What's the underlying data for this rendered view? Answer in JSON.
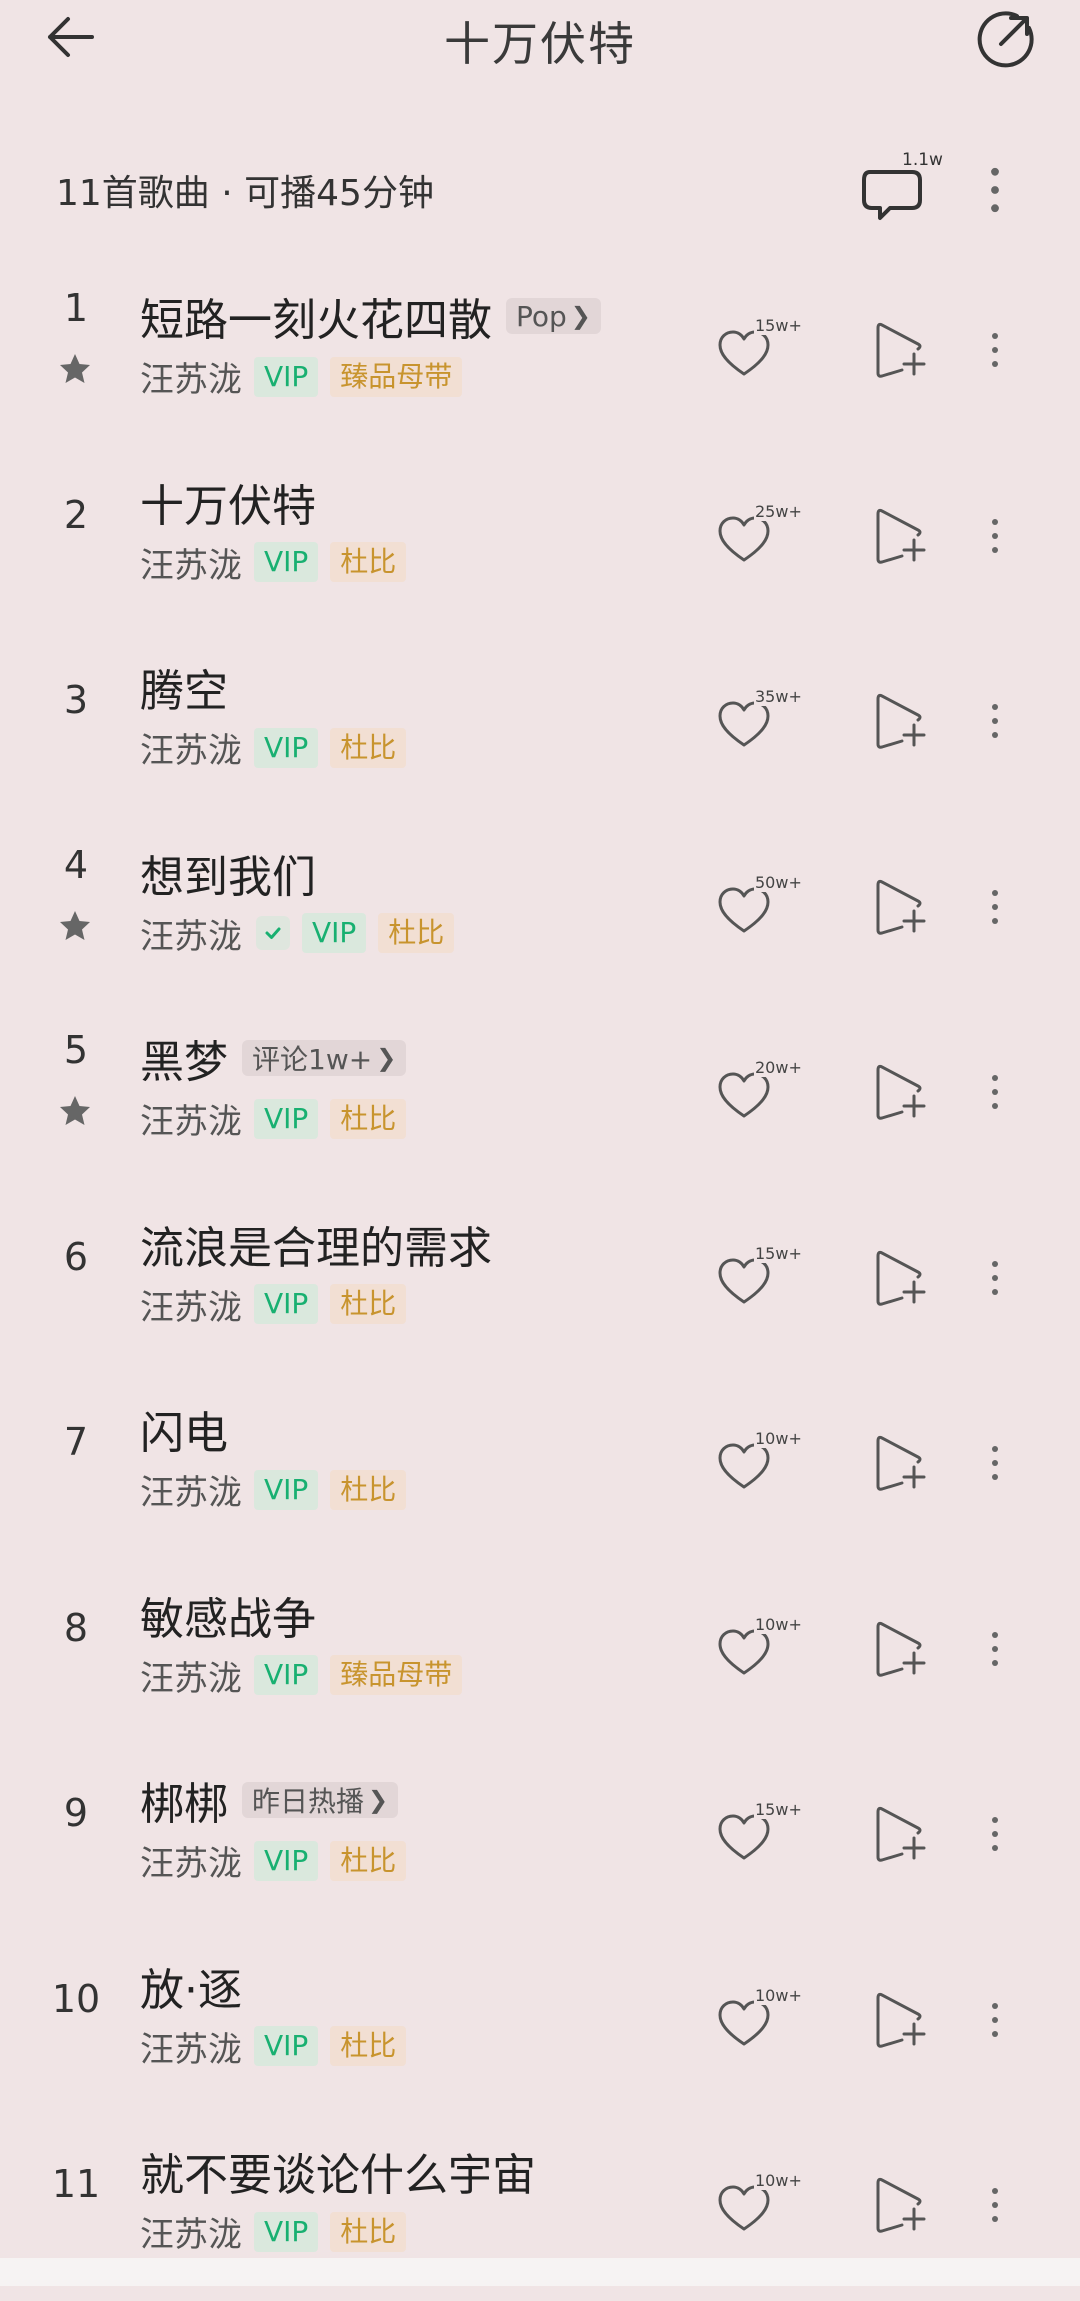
{
  "header": {
    "title": "十万伏特",
    "back_icon": "arrow-left-icon",
    "share_icon": "share-icon"
  },
  "summary": {
    "text": "11首歌曲 · 可播45分钟",
    "comment_count": "1.1w",
    "comment_icon": "comment-icon",
    "more_icon": "more-vertical-icon"
  },
  "colors": {
    "background": "#f0e4e5",
    "vip_green": "#18b071",
    "quality_gold": "#c8942e"
  },
  "songs": [
    {
      "index": "1",
      "title": "短路一刻火花四散",
      "tag": "Pop",
      "artist": "汪苏泷",
      "verified": false,
      "vip": "VIP",
      "quality": "臻品母带",
      "likes": "15w+",
      "starred": true
    },
    {
      "index": "2",
      "title": "十万伏特",
      "tag": "",
      "artist": "汪苏泷",
      "verified": false,
      "vip": "VIP",
      "quality": "杜比",
      "likes": "25w+",
      "starred": false
    },
    {
      "index": "3",
      "title": "腾空",
      "tag": "",
      "artist": "汪苏泷",
      "verified": false,
      "vip": "VIP",
      "quality": "杜比",
      "likes": "35w+",
      "starred": false
    },
    {
      "index": "4",
      "title": "想到我们",
      "tag": "",
      "artist": "汪苏泷",
      "verified": true,
      "vip": "VIP",
      "quality": "杜比",
      "likes": "50w+",
      "starred": true
    },
    {
      "index": "5",
      "title": "黑梦",
      "tag": "评论1w+",
      "artist": "汪苏泷",
      "verified": false,
      "vip": "VIP",
      "quality": "杜比",
      "likes": "20w+",
      "starred": true
    },
    {
      "index": "6",
      "title": "流浪是合理的需求",
      "tag": "",
      "artist": "汪苏泷",
      "verified": false,
      "vip": "VIP",
      "quality": "杜比",
      "likes": "15w+",
      "starred": false
    },
    {
      "index": "7",
      "title": "闪电",
      "tag": "",
      "artist": "汪苏泷",
      "verified": false,
      "vip": "VIP",
      "quality": "杜比",
      "likes": "10w+",
      "starred": false
    },
    {
      "index": "8",
      "title": "敏感战争",
      "tag": "",
      "artist": "汪苏泷",
      "verified": false,
      "vip": "VIP",
      "quality": "臻品母带",
      "likes": "10w+",
      "starred": false
    },
    {
      "index": "9",
      "title": "梆梆",
      "tag": "昨日热播",
      "artist": "汪苏泷",
      "verified": false,
      "vip": "VIP",
      "quality": "杜比",
      "likes": "15w+",
      "starred": false
    },
    {
      "index": "10",
      "title": "放·逐",
      "tag": "",
      "artist": "汪苏泷",
      "verified": false,
      "vip": "VIP",
      "quality": "杜比",
      "likes": "10w+",
      "starred": false
    },
    {
      "index": "11",
      "title": "就不要谈论什么宇宙",
      "tag": "",
      "artist": "汪苏泷",
      "verified": false,
      "vip": "VIP",
      "quality": "杜比",
      "likes": "10w+",
      "starred": false
    }
  ]
}
